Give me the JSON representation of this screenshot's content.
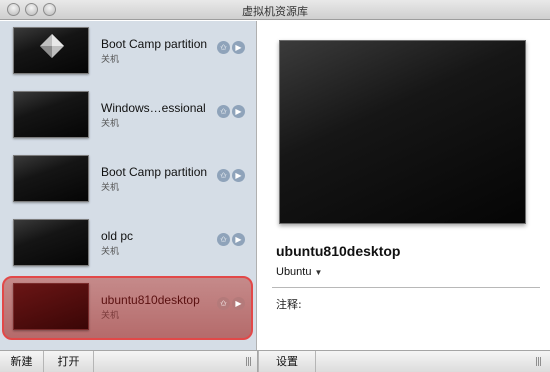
{
  "window": {
    "title": "虚拟机资源库"
  },
  "vm_list": [
    {
      "name": "Boot Camp partition",
      "status": "关机",
      "thumbnail": "bootcamp-logo"
    },
    {
      "name": "Windows…essional",
      "status": "关机",
      "thumbnail": "black-screen"
    },
    {
      "name": "Boot Camp partition",
      "status": "关机",
      "thumbnail": "black-screen"
    },
    {
      "name": "old pc",
      "status": "关机",
      "thumbnail": "black-screen"
    },
    {
      "name": "ubuntu810desktop",
      "status": "关机",
      "thumbnail": "black-screen",
      "selected": true
    }
  ],
  "detail": {
    "vm_title": "ubuntu810desktop",
    "os": "Ubuntu",
    "notes_label": "注释:"
  },
  "toolbar": {
    "new_label": "新建",
    "open_label": "打开",
    "settings_label": "设置"
  },
  "icons": {
    "favorite": "star-icon",
    "start": "play-icon"
  },
  "colors": {
    "selection_border": "#e24848",
    "selection_fill": "#c58a8a",
    "sidebar_bg": "#d5dde6"
  }
}
